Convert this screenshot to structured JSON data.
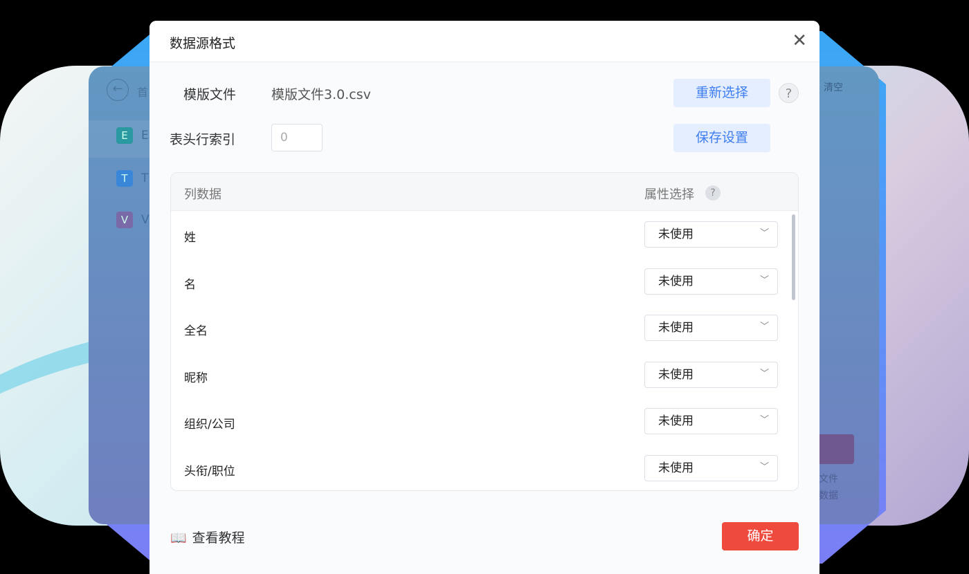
{
  "background_app": {
    "breadcrumb": "首",
    "clear": "清空",
    "sidebar": [
      {
        "letter": "E",
        "label": "E",
        "color": "#2a9aa0"
      },
      {
        "letter": "T",
        "label": "T",
        "color": "#3a86d8"
      },
      {
        "letter": "V",
        "label": "V",
        "color": "#7a6aa8"
      }
    ],
    "hint_lines": [
      "文件",
      "数据"
    ]
  },
  "dialog": {
    "title": "数据源格式",
    "template_label": "模版文件",
    "template_file": "模版文件3.0.csv",
    "reselect": "重新选择",
    "header_index_label": "表头行索引",
    "header_index_value": "0",
    "save_settings": "保存设置",
    "table": {
      "col_header": "列数据",
      "attr_header": "属性选择",
      "rows": [
        {
          "name": "姓",
          "value": "未使用"
        },
        {
          "name": "名",
          "value": "未使用"
        },
        {
          "name": "全名",
          "value": "未使用"
        },
        {
          "name": "昵称",
          "value": "未使用"
        },
        {
          "name": "组织/公司",
          "value": "未使用"
        },
        {
          "name": "头衔/职位",
          "value": "未使用"
        }
      ]
    },
    "tutorial": "查看教程",
    "confirm": "确定",
    "confirm_color": "#ef4a3e",
    "accent": "#3e7ef0"
  }
}
